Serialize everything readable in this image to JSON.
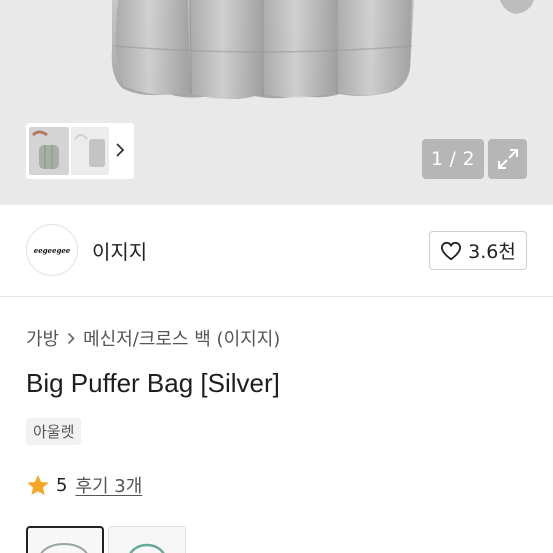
{
  "gallery": {
    "counter_current": "1",
    "counter_sep": "/",
    "counter_total": "2"
  },
  "shop": {
    "logo_text": "eegeegee",
    "name": "이지지",
    "like_count": "3.6천"
  },
  "product": {
    "breadcrumb": [
      "가방",
      "메신저/크로스 백 (이지지)"
    ],
    "title": "Big Puffer Bag [Silver]",
    "tag": "아울렛",
    "rating": "5",
    "reviews": "후기 3개"
  },
  "colors": {
    "star": "#f6a623",
    "hero_bg": "#e9e9e9",
    "bag_silver": "#b9b9b9"
  },
  "icons": {
    "thumb_next": "chevron-right-icon",
    "expand": "expand-icon",
    "like": "heart-outline-icon",
    "breadcrumb_sep": "chevron-right-icon",
    "star": "star-icon"
  }
}
